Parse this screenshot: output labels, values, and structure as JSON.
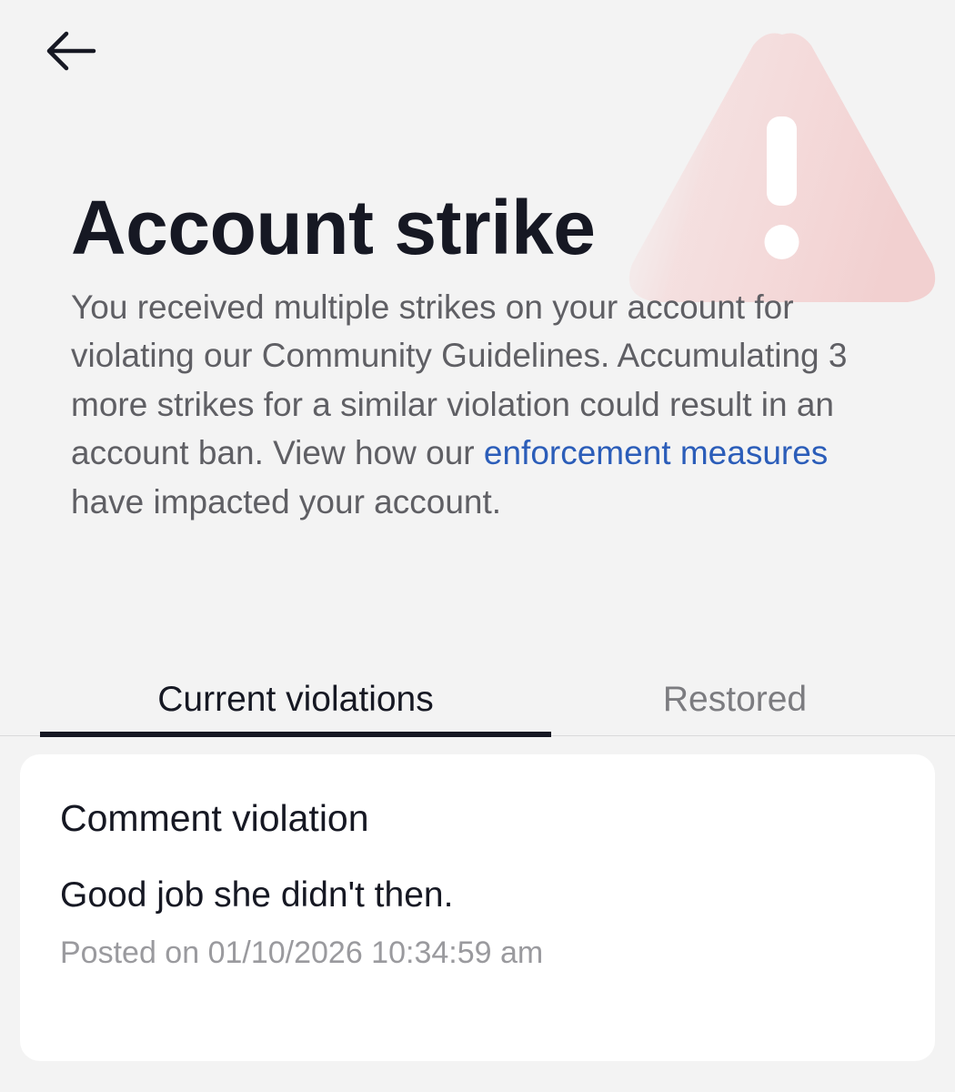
{
  "header": {
    "back_icon": "arrow-left-icon",
    "warning_icon": "warning-triangle-icon",
    "warning_color": "#f2d0d0"
  },
  "title": "Account strike",
  "description": {
    "text_before_link": "You received multiple strikes on your account for violating our Community Guidelines. Accumulating 3 more strikes for a similar violation could result in an account ban. View how our ",
    "link_text": "enforcement measures",
    "text_after_link": " have impacted your account.",
    "link_color": "#2b5db9"
  },
  "tabs": [
    {
      "label": "Current violations",
      "active": true
    },
    {
      "label": "Restored",
      "active": false
    }
  ],
  "violation": {
    "title": "Comment violation",
    "comment": "Good job she didn't then.",
    "posted": "Posted on 01/10/2026 10:34:59 am"
  }
}
